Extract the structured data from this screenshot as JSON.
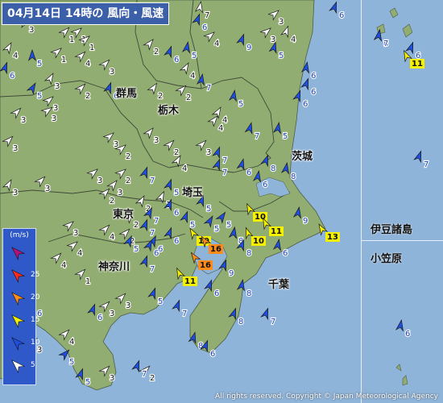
{
  "title": "04月14日 14時の 風向・風速",
  "copyright": "All rights reserved. Copyright © Japan Meteorological Agency",
  "legend": {
    "unit": "(m/s)",
    "levels": [
      "25",
      "20",
      "15",
      "10",
      "5"
    ],
    "colors": {
      "25plus": "#b4127a",
      "25": "#ff2a1a",
      "20": "#ff8c1a",
      "15": "#f5f000",
      "10": "#1f4fe0",
      "5": "#ffffff"
    }
  },
  "places": {
    "gunma": "群馬",
    "tochigi": "栃木",
    "ibaraki": "茨城",
    "saitama": "埼玉",
    "tokyo": "東京",
    "kanagawa": "神奈川",
    "chiba": "千葉",
    "izu": "伊豆諸島",
    "ogasawara": "小笠原"
  },
  "winds": [
    {
      "speed": "1",
      "color": "white"
    },
    {
      "speed": "3",
      "color": "white"
    },
    {
      "speed": "4",
      "color": "white"
    },
    {
      "speed": "1",
      "color": "white"
    },
    {
      "speed": "5",
      "color": "blue"
    },
    {
      "speed": "6",
      "color": "blue"
    },
    {
      "speed": "4",
      "color": "white"
    },
    {
      "speed": "7",
      "color": "white"
    },
    {
      "speed": "6",
      "color": "blue"
    },
    {
      "speed": "3",
      "color": "white"
    },
    {
      "speed": "3",
      "color": "white"
    },
    {
      "speed": "1",
      "color": "white"
    },
    {
      "speed": "3",
      "color": "white"
    },
    {
      "speed": "3",
      "color": "white"
    },
    {
      "speed": "2",
      "color": "white"
    },
    {
      "speed": "2",
      "color": "white"
    },
    {
      "speed": "6",
      "color": "blue"
    },
    {
      "speed": "4",
      "color": "white"
    },
    {
      "speed": "5",
      "color": "blue"
    },
    {
      "speed": "4",
      "color": "white"
    },
    {
      "speed": "9",
      "color": "blue"
    },
    {
      "speed": "4",
      "color": "white"
    },
    {
      "speed": "3",
      "color": "white"
    },
    {
      "speed": "5",
      "color": "blue"
    },
    {
      "speed": "6",
      "color": "blue"
    },
    {
      "speed": "7",
      "color": "blue"
    },
    {
      "speed": "5",
      "color": "blue"
    },
    {
      "speed": "6",
      "color": "blue"
    },
    {
      "speed": "3",
      "color": "white"
    },
    {
      "speed": "3",
      "color": "white"
    },
    {
      "speed": "2",
      "color": "white"
    },
    {
      "speed": "2",
      "color": "white"
    },
    {
      "speed": "4",
      "color": "white"
    },
    {
      "speed": "5",
      "color": "blue"
    },
    {
      "speed": "7",
      "color": "blue"
    },
    {
      "speed": "6",
      "color": "blue"
    },
    {
      "speed": "3",
      "color": "white"
    },
    {
      "speed": "3",
      "color": "white"
    },
    {
      "speed": "3",
      "color": "white"
    },
    {
      "speed": "2",
      "color": "white"
    },
    {
      "speed": "2",
      "color": "white"
    },
    {
      "speed": "3",
      "color": "white"
    },
    {
      "speed": "4",
      "color": "white"
    },
    {
      "speed": "5",
      "color": "blue"
    },
    {
      "speed": "6",
      "color": "blue"
    },
    {
      "speed": "7",
      "color": "blue"
    },
    {
      "speed": "6",
      "color": "blue"
    },
    {
      "speed": "8",
      "color": "blue"
    },
    {
      "speed": "4",
      "color": "white"
    },
    {
      "speed": "7",
      "color": "blue"
    },
    {
      "speed": "6",
      "color": "blue"
    },
    {
      "speed": "3",
      "color": "white"
    },
    {
      "speed": "5",
      "color": "blue"
    },
    {
      "speed": "7",
      "color": "blue"
    },
    {
      "speed": "8",
      "color": "blue"
    },
    {
      "speed": "2",
      "color": "white"
    },
    {
      "speed": "3",
      "color": "white"
    },
    {
      "speed": "3",
      "color": "white"
    },
    {
      "speed": "3",
      "color": "white"
    },
    {
      "speed": "2",
      "color": "white"
    },
    {
      "speed": "2",
      "color": "white"
    },
    {
      "speed": "1",
      "color": "white"
    },
    {
      "speed": "2",
      "color": "white"
    },
    {
      "speed": "4",
      "color": "white"
    },
    {
      "speed": "7",
      "color": "blue"
    },
    {
      "speed": "6",
      "color": "blue"
    },
    {
      "speed": "5",
      "color": "blue"
    },
    {
      "speed": "7",
      "color": "blue"
    },
    {
      "speed": "5",
      "color": "blue"
    },
    {
      "speed": "5",
      "color": "blue"
    },
    {
      "speed": "2",
      "color": "white"
    },
    {
      "speed": "3",
      "color": "white"
    },
    {
      "speed": "4",
      "color": "white"
    },
    {
      "speed": "1",
      "color": "white"
    },
    {
      "speed": "6",
      "color": "blue"
    },
    {
      "speed": "6",
      "color": "blue"
    },
    {
      "speed": "5",
      "color": "blue"
    },
    {
      "speed": "5",
      "color": "blue"
    },
    {
      "speed": "8",
      "color": "blue"
    },
    {
      "speed": "10",
      "color": "yellow"
    },
    {
      "speed": "10",
      "color": "yellow"
    },
    {
      "speed": "11",
      "color": "yellow"
    },
    {
      "speed": "9",
      "color": "blue"
    },
    {
      "speed": "13",
      "color": "yellow"
    },
    {
      "speed": "10",
      "color": "yellow"
    },
    {
      "speed": "16",
      "color": "orange"
    },
    {
      "speed": "16",
      "color": "orange"
    },
    {
      "speed": "11",
      "color": "yellow"
    },
    {
      "speed": "7",
      "color": "blue"
    },
    {
      "speed": "6",
      "color": "blue"
    },
    {
      "speed": "4",
      "color": "white"
    },
    {
      "speed": "8",
      "color": "blue"
    },
    {
      "speed": "5",
      "color": "blue"
    },
    {
      "speed": "9",
      "color": "blue"
    },
    {
      "speed": "6",
      "color": "blue"
    },
    {
      "speed": "8",
      "color": "blue"
    },
    {
      "speed": "3",
      "color": "white"
    },
    {
      "speed": "6",
      "color": "blue"
    },
    {
      "speed": "3",
      "color": "white"
    },
    {
      "speed": "7",
      "color": "blue"
    },
    {
      "speed": "5",
      "color": "blue"
    },
    {
      "speed": "8",
      "color": "blue"
    },
    {
      "speed": "7",
      "color": "blue"
    },
    {
      "speed": "6",
      "color": "blue"
    },
    {
      "speed": "8",
      "color": "blue"
    },
    {
      "speed": "6",
      "color": "blue"
    },
    {
      "speed": "2",
      "color": "white"
    },
    {
      "speed": "7",
      "color": "blue"
    },
    {
      "speed": "5",
      "color": "blue"
    },
    {
      "speed": "3",
      "color": "white"
    },
    {
      "speed": "5",
      "color": "blue"
    },
    {
      "speed": "3",
      "color": "white"
    },
    {
      "speed": "4",
      "color": "white"
    },
    {
      "speed": "6",
      "color": "blue"
    },
    {
      "speed": "1",
      "color": "white"
    },
    {
      "speed": "8",
      "color": "blue"
    },
    {
      "speed": "7",
      "color": "blue"
    },
    {
      "speed": "6",
      "color": "blue"
    },
    {
      "speed": "11",
      "color": "yellow"
    },
    {
      "speed": "6",
      "color": "blue"
    },
    {
      "speed": "7",
      "color": "blue"
    },
    {
      "speed": "6",
      "color": "blue"
    }
  ]
}
